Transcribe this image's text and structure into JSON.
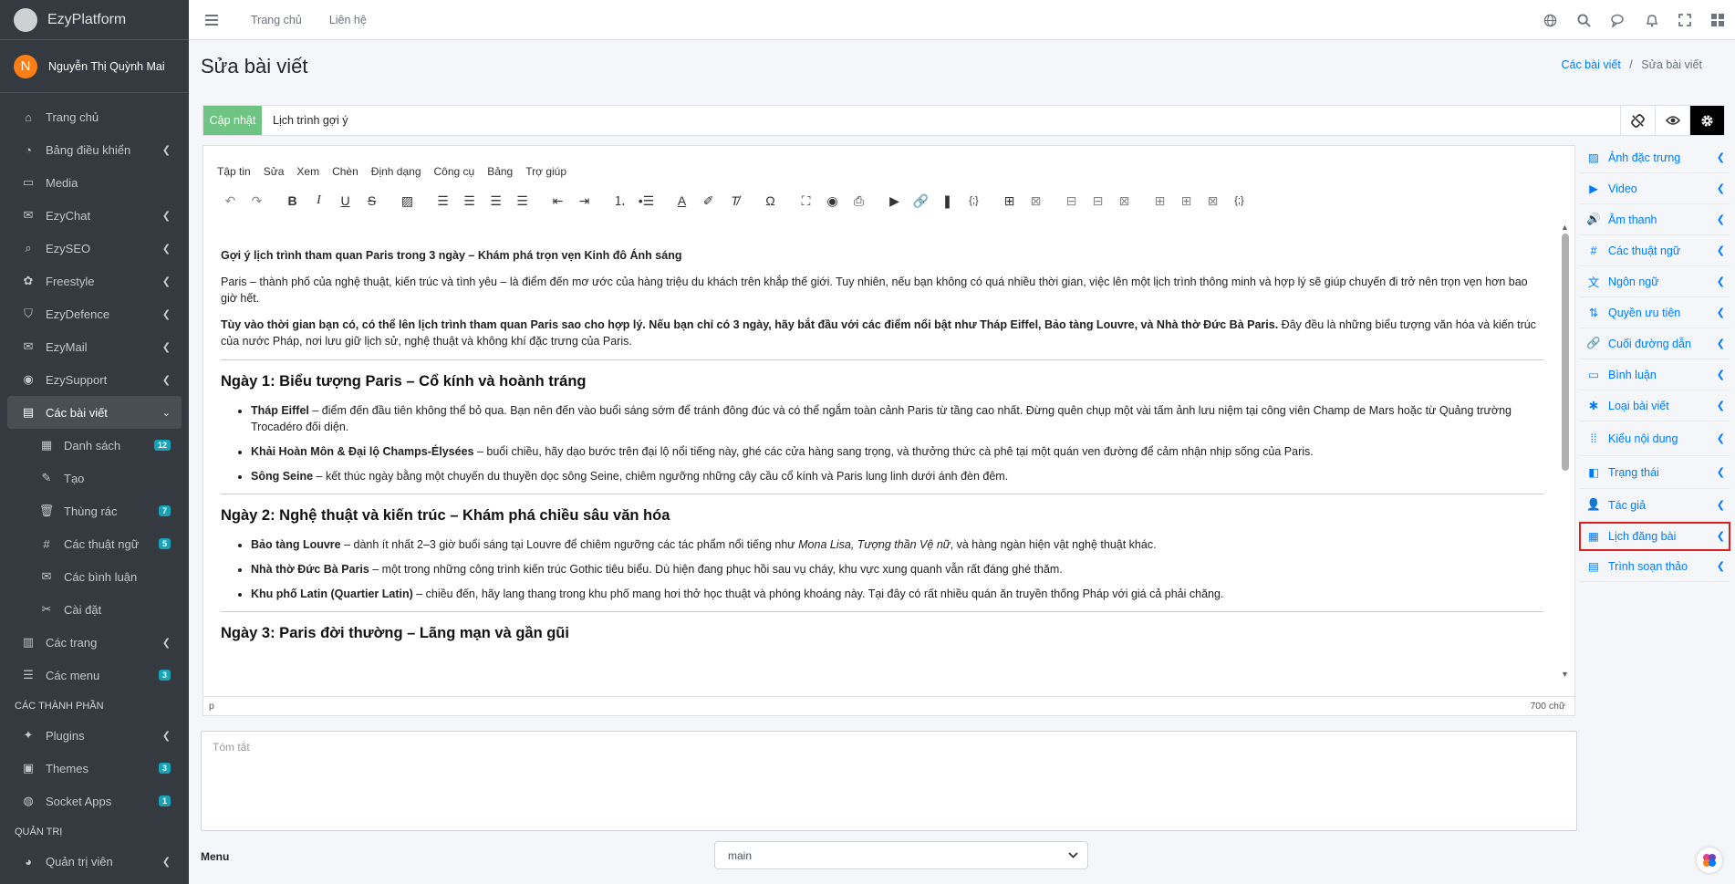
{
  "brand": {
    "name": "EzyPlatform"
  },
  "user": {
    "initial": "N",
    "name": "Nguyễn Thị Quỳnh Mai"
  },
  "sidebar": {
    "items": [
      {
        "label": "Trang chủ",
        "icon": "home-icon",
        "chevron": false
      },
      {
        "label": "Bảng điều khiển",
        "icon": "dashboard-icon",
        "chevron": true
      },
      {
        "label": "Media",
        "icon": "media-icon",
        "chevron": false
      },
      {
        "label": "EzyChat",
        "icon": "chat-icon",
        "chevron": true
      },
      {
        "label": "EzySEO",
        "icon": "seo-icon",
        "chevron": true
      },
      {
        "label": "Freestyle",
        "icon": "freestyle-icon",
        "chevron": true
      },
      {
        "label": "EzyDefence",
        "icon": "shield-icon",
        "chevron": true
      },
      {
        "label": "EzyMail",
        "icon": "mail-icon",
        "chevron": true
      },
      {
        "label": "EzySupport",
        "icon": "support-icon",
        "chevron": true
      },
      {
        "label": "Các bài viết",
        "icon": "posts-icon",
        "chevron": true,
        "open": true
      }
    ],
    "sub_items": [
      {
        "label": "Danh sách",
        "icon": "list-icon",
        "badge": "12"
      },
      {
        "label": "Tạo",
        "icon": "edit-icon",
        "badge": ""
      },
      {
        "label": "Thùng rác",
        "icon": "trash-icon",
        "badge": "7"
      },
      {
        "label": "Các thuật ngữ",
        "icon": "hash-icon",
        "badge": "5"
      },
      {
        "label": "Các bình luận",
        "icon": "comments-icon",
        "badge": ""
      },
      {
        "label": "Cài đặt",
        "icon": "tools-icon",
        "badge": ""
      }
    ],
    "items2": [
      {
        "label": "Các trang",
        "icon": "pages-icon",
        "chevron": true,
        "badge": ""
      },
      {
        "label": "Các menu",
        "icon": "menu-icon",
        "chevron": false,
        "badge": "3"
      }
    ],
    "section_components": "CÁC THÀNH PHẦN",
    "items3": [
      {
        "label": "Plugins",
        "icon": "plugin-icon",
        "chevron": true,
        "badge": ""
      },
      {
        "label": "Themes",
        "icon": "themes-icon",
        "chevron": false,
        "badge": "3"
      },
      {
        "label": "Socket Apps",
        "icon": "socket-icon",
        "chevron": false,
        "badge": "1"
      }
    ],
    "section_admin": "QUẢN TRỊ",
    "items4": [
      {
        "label": "Quản trị viên",
        "icon": "admin-icon",
        "chevron": true,
        "badge": ""
      }
    ]
  },
  "topbar": {
    "home": "Trang chủ",
    "contact": "Liên hệ"
  },
  "page": {
    "title": "Sửa bài viết"
  },
  "breadcrumb": {
    "parent": "Các bài viết",
    "sep": "/",
    "current": "Sửa bài viết"
  },
  "post": {
    "update_label": "Cập nhật",
    "title_value": "Lịch trình gợi ý"
  },
  "editor": {
    "menus": [
      "Tập tin",
      "Sửa",
      "Xem",
      "Chèn",
      "Định dạng",
      "Công cụ",
      "Bảng",
      "Trợ giúp"
    ],
    "content": {
      "intro_title": "Gợi ý lịch trình tham quan Paris trong 3 ngày – Khám phá trọn vẹn Kinh đô Ánh sáng",
      "p1": "Paris – thành phố của nghệ thuật, kiến trúc và tình yêu – là điểm đến mơ ước của hàng triệu du khách trên khắp thế giới. Tuy nhiên, nếu bạn không có quá nhiều thời gian, việc lên một lịch trình thông minh và hợp lý sẽ giúp chuyến đi trở nên trọn vẹn hơn bao giờ hết.",
      "p2_bold": "Tùy vào thời gian bạn có, có thể lên lịch trình tham quan Paris sao cho hợp lý. Nếu bạn chỉ có 3 ngày, hãy bắt đầu với các điểm nổi bật như Tháp Eiffel, Bảo tàng Louvre, và Nhà thờ Đức Bà Paris.",
      "p2_rest": " Đây đều là những biểu tượng văn hóa và kiến trúc của nước Pháp, nơi lưu giữ lịch sử, nghệ thuật và không khí đặc trưng của Paris.",
      "day1_title": "Ngày 1: Biểu tượng Paris – Cổ kính và hoành tráng",
      "day1": [
        {
          "b": "Tháp Eiffel",
          "t": " – điểm đến đầu tiên không thể bỏ qua. Bạn nên đến vào buổi sáng sớm để tránh đông đúc và có thể ngắm toàn cảnh Paris từ tầng cao nhất. Đừng quên chụp một vài tấm ảnh lưu niệm tại công viên Champ de Mars hoặc từ Quảng trường Trocadéro đối diện."
        },
        {
          "b": "Khải Hoàn Môn & Đại lộ Champs-Élysées",
          "t": " – buổi chiều, hãy dạo bước trên đại lộ nổi tiếng này, ghé các cửa hàng sang trọng, và thưởng thức cà phê tại một quán ven đường để cảm nhận nhịp sống của Paris."
        },
        {
          "b": "Sông Seine",
          "t": " – kết thúc ngày bằng một chuyến du thuyền dọc sông Seine, chiêm ngưỡng những cây cầu cổ kính và Paris lung linh dưới ánh đèn đêm."
        }
      ],
      "day2_title": "Ngày 2: Nghệ thuật và kiến trúc – Khám phá chiều sâu văn hóa",
      "day2_louvre_b": "Bảo tàng Louvre",
      "day2_louvre_t1": " – dành ít nhất 2–3 giờ buổi sáng tại Louvre để chiêm ngưỡng các tác phẩm nổi tiếng như ",
      "day2_louvre_i": "Mona Lisa, Tượng thần Vệ nữ",
      "day2_louvre_t2": ", và hàng ngàn hiện vật nghệ thuật khác.",
      "day2_nd_b": "Nhà thờ Đức Bà Paris",
      "day2_nd_t": " – một trong những công trình kiến trúc Gothic tiêu biểu. Dù hiện đang phục hồi sau vụ cháy, khu vực xung quanh vẫn rất đáng ghé thăm.",
      "day2_latin_b": "Khu phố Latin (Quartier Latin)",
      "day2_latin_t": " – chiều đến, hãy lang thang trong khu phố mang hơi thở học thuật và phóng khoáng này. Tại đây có rất nhiều quán ăn truyền thống Pháp với giá cả phải chăng.",
      "day3_title": "Ngày 3: Paris đời thường – Lãng mạn và gần gũi"
    },
    "status_path": "p",
    "word_count": "700 chữ"
  },
  "summary": {
    "placeholder": "Tóm tắt"
  },
  "menu_field": {
    "label": "Menu",
    "value": "main"
  },
  "right_panel": [
    {
      "label": "Ảnh đặc trưng",
      "icon": "image-icon"
    },
    {
      "label": "Video",
      "icon": "video-icon"
    },
    {
      "label": "Âm thanh",
      "icon": "audio-icon"
    },
    {
      "label": "Các thuật ngữ",
      "icon": "hash-icon"
    },
    {
      "label": "Ngôn ngữ",
      "icon": "language-icon"
    },
    {
      "label": "Quyền ưu tiên",
      "icon": "priority-icon"
    },
    {
      "label": "Cuối đường dẫn",
      "icon": "link-icon"
    },
    {
      "label": "Bình luận",
      "icon": "comment-icon"
    },
    {
      "label": "Loại bài viết",
      "icon": "asterisk-icon"
    },
    {
      "label": "Kiểu nội dung",
      "icon": "grid-icon"
    },
    {
      "label": "Trạng thái",
      "icon": "toggle-icon"
    },
    {
      "label": "Tác giả",
      "icon": "user-icon"
    },
    {
      "label": "Lịch đăng bài",
      "icon": "calendar-icon",
      "highlight": true
    },
    {
      "label": "Trình soạn thảo",
      "icon": "editor-icon"
    }
  ],
  "colors": {
    "sidebar_bg": "#343a40",
    "accent": "#007bff",
    "update_btn": "#6fc383",
    "highlight_border": "#e02020"
  }
}
